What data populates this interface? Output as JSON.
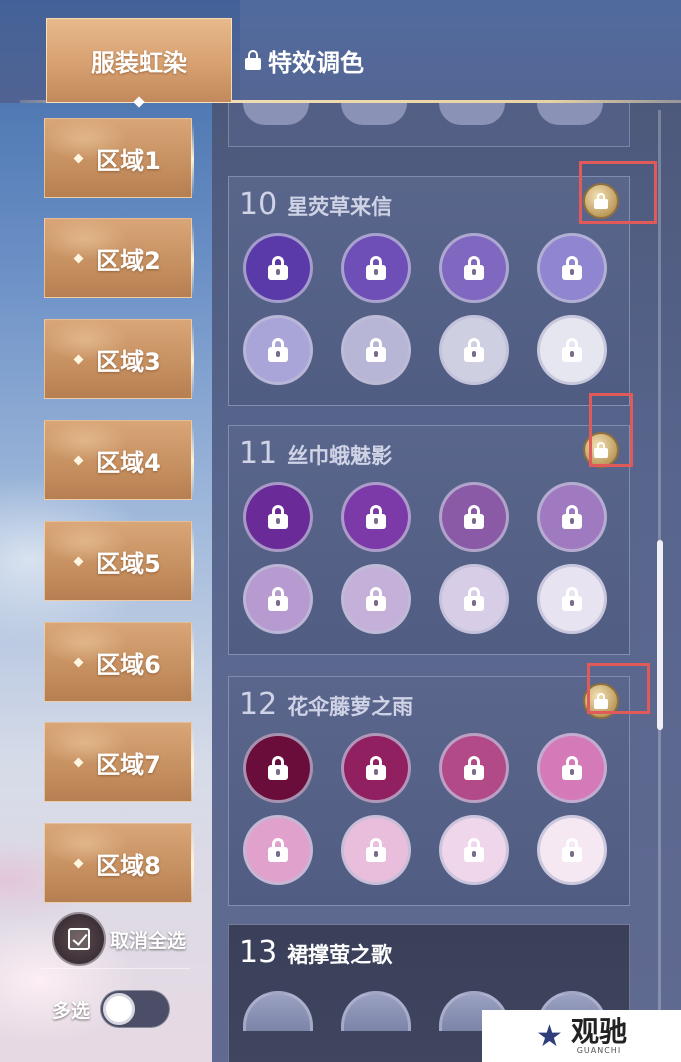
{
  "tabs": {
    "active_label": "服装虹染",
    "locked_label": "特效调色"
  },
  "sidebar": {
    "zones": [
      "区域1",
      "区域2",
      "区域3",
      "区域4",
      "区域5",
      "区域6",
      "区域7",
      "区域8"
    ]
  },
  "controls": {
    "cancel_all_label": "取消全选",
    "multi_select_label": "多选",
    "multi_select_on": false
  },
  "groups": [
    {
      "number": "10",
      "name": "星荧草来信",
      "locked": true,
      "swatches": [
        "#5a3aa8",
        "#6e4fb8",
        "#8067c0",
        "#8f85d0",
        "#a9a5d8",
        "#b8b6d6",
        "#cfcfe2",
        "#e6e6f0"
      ]
    },
    {
      "number": "11",
      "name": "丝巾蛾魅影",
      "locked": true,
      "swatches": [
        "#6a2a98",
        "#7c3aa8",
        "#8a5aa6",
        "#a07ac0",
        "#b69ad0",
        "#c4b0d8",
        "#d8cde6",
        "#e8e3f0"
      ]
    },
    {
      "number": "12",
      "name": "花伞藤萝之雨",
      "locked": true,
      "swatches": [
        "#6a0d3a",
        "#902060",
        "#b24a88",
        "#d47ab8",
        "#e0a2cc",
        "#e8bedc",
        "#efd6ea",
        "#f5e8f2"
      ]
    },
    {
      "number": "13",
      "name": "裙撑萤之歌",
      "locked": false,
      "swatches": []
    }
  ],
  "colors": {
    "highlight": "#e05a5a",
    "tab_gold": "#d7a070"
  },
  "watermark": {
    "main": "观驰",
    "sub": "GUANCHI"
  }
}
